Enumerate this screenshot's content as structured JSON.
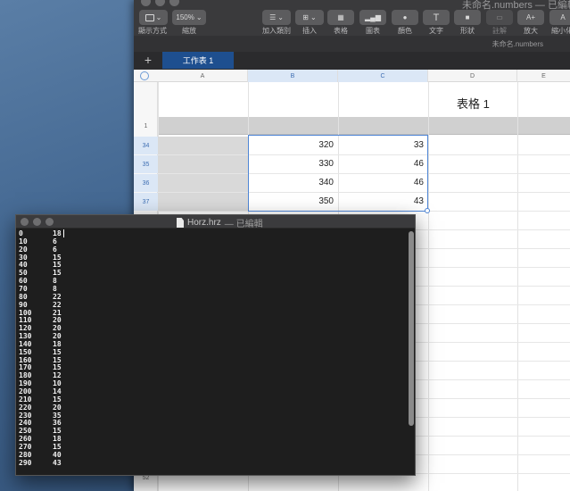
{
  "numbers": {
    "window_title": "未命名.numbers — 已編輯",
    "filename": "未命名.numbers",
    "toolbar": {
      "view_label": "顯示方式",
      "zoom_value": "150%",
      "zoom_label": "縮放",
      "add_category_label": "加入類別",
      "insert_label": "插入",
      "table_label": "表格",
      "chart_label": "圖表",
      "color_label": "顏色",
      "text_label": "文字",
      "shape_label": "形狀",
      "comment_label": "註解",
      "bigger_label": "放大",
      "smaller_label": "縮小化",
      "text_icon": "T",
      "bigger_icon": "A+"
    },
    "add_sheet": "+",
    "sheet_tab": "工作表 1",
    "columns": [
      "A",
      "B",
      "C",
      "D",
      "E"
    ],
    "table_title": "表格 1",
    "header_row_number": "1",
    "rows": [
      {
        "row": "34",
        "b": "320",
        "c": "33"
      },
      {
        "row": "35",
        "b": "330",
        "c": "46"
      },
      {
        "row": "36",
        "b": "340",
        "c": "46"
      },
      {
        "row": "37",
        "b": "350",
        "c": "43"
      }
    ],
    "bottom_row_number": "52"
  },
  "editor": {
    "filename": "Horz.hrz",
    "status": " — 已編輯",
    "lines": [
      [
        "0",
        "18"
      ],
      [
        "10",
        "6"
      ],
      [
        "20",
        "6"
      ],
      [
        "30",
        "15"
      ],
      [
        "40",
        "15"
      ],
      [
        "50",
        "15"
      ],
      [
        "60",
        "8"
      ],
      [
        "70",
        "8"
      ],
      [
        "80",
        "22"
      ],
      [
        "90",
        "22"
      ],
      [
        "100",
        "21"
      ],
      [
        "110",
        "20"
      ],
      [
        "120",
        "20"
      ],
      [
        "130",
        "20"
      ],
      [
        "140",
        "18"
      ],
      [
        "150",
        "15"
      ],
      [
        "160",
        "15"
      ],
      [
        "170",
        "15"
      ],
      [
        "180",
        "12"
      ],
      [
        "190",
        "10"
      ],
      [
        "200",
        "14"
      ],
      [
        "210",
        "15"
      ],
      [
        "220",
        "20"
      ],
      [
        "230",
        "35"
      ],
      [
        "240",
        "36"
      ],
      [
        "250",
        "15"
      ],
      [
        "260",
        "18"
      ],
      [
        "270",
        "15"
      ],
      [
        "280",
        "40"
      ],
      [
        "290",
        "43"
      ]
    ]
  }
}
